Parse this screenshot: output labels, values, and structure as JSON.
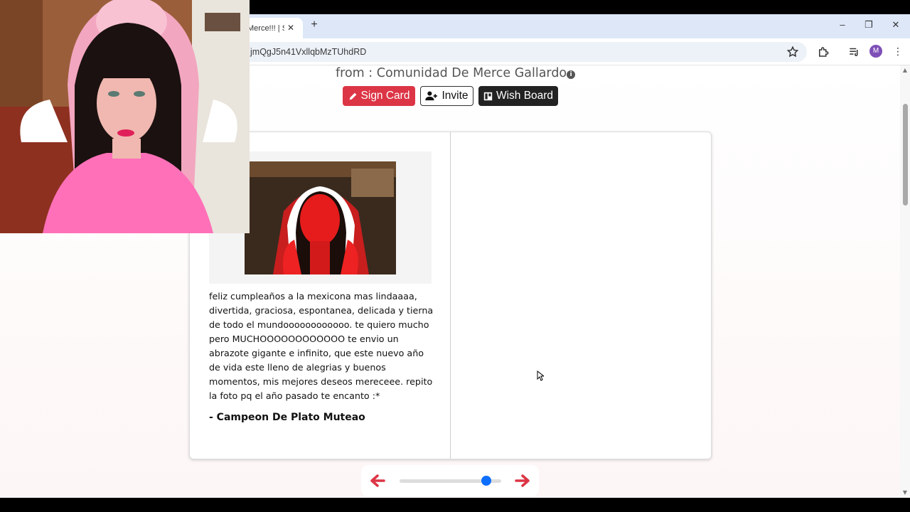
{
  "browser": {
    "tab_title": "Merce!!! | S",
    "url": "jmQgJ5n41VxllqbMzTUhdRD",
    "profile_initial": "M"
  },
  "icons": {
    "star": "star-icon",
    "extensions": "puzzle-icon",
    "media": "media-queue-icon",
    "menu": "kebab-menu-icon",
    "info": "info-icon",
    "pencil": "pencil-icon",
    "user_plus": "user-plus-icon",
    "board": "board-icon"
  },
  "header": {
    "from_text": "from : Comunidad De Merce Gallardo"
  },
  "actions": {
    "sign_label": "Sign Card",
    "invite_label": "Invite",
    "wish_label": "Wish Board"
  },
  "card": {
    "message": "feliz cumpleaños a la mexicona mas lindaaaa, divertida, graciosa, espontanea, delicada y tierna de todo el mundoooooooooooo. te quiero mucho pero MUCHOOOOOOOOOOOO te envio un abrazote gigante e infinito, que este nuevo año de vida este lleno de alegrias y buenos momentos, mis mejores deseos mereceee. repito la foto pq el año pasado te encanto :*",
    "signer": "- Campeon De Plato Muteao"
  },
  "navigation": {
    "slider_fraction": 0.85
  },
  "colors": {
    "accent_red": "#dc3545",
    "slider_blue": "#0d6efd",
    "dark_button": "#222222"
  }
}
